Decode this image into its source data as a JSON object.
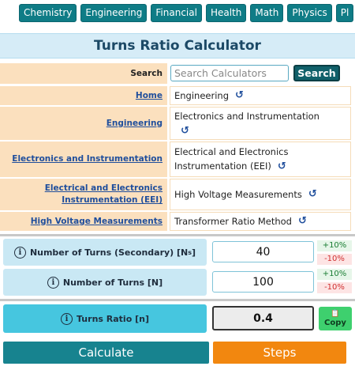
{
  "topnav": {
    "tabs": [
      "Chemistry",
      "Engineering",
      "Financial",
      "Health",
      "Math",
      "Physics",
      "Pl"
    ]
  },
  "title": "Turns Ratio Calculator",
  "search": {
    "label": "Search",
    "placeholder": "Search Calculators",
    "button": "Search"
  },
  "breadcrumb_rows": [
    {
      "left": "Home",
      "right": "Engineering",
      "refresh": "↺"
    },
    {
      "left": "Engineering",
      "right": "Electronics and Instrumentation",
      "refresh": "↺"
    },
    {
      "left": "Electronics and Instrumentation",
      "right": "Electrical and Electronics Instrumentation (EEI)",
      "refresh": "↺"
    },
    {
      "left": "Electrical and Electronics Instrumentation (EEI)",
      "right": "High Voltage Measurements",
      "refresh": "↺"
    },
    {
      "left": "High Voltage Measurements",
      "right": "Transformer Ratio Method",
      "refresh": "↺"
    }
  ],
  "inputs": [
    {
      "label": "Number of Turns (Secondary) [N",
      "sub": "s",
      "label_end": "]",
      "value": "40",
      "plus": "+10%",
      "minus": "-10%"
    },
    {
      "label": "Number of Turns [N]",
      "value": "100",
      "plus": "+10%",
      "minus": "-10%"
    }
  ],
  "result": {
    "label": "Turns Ratio [n]",
    "value": "0.4",
    "copy_label": "Copy",
    "copy_icon": "clipboard-icon"
  },
  "info_glyph": "i",
  "buttons": {
    "calculate": "Calculate",
    "steps": "Steps"
  }
}
